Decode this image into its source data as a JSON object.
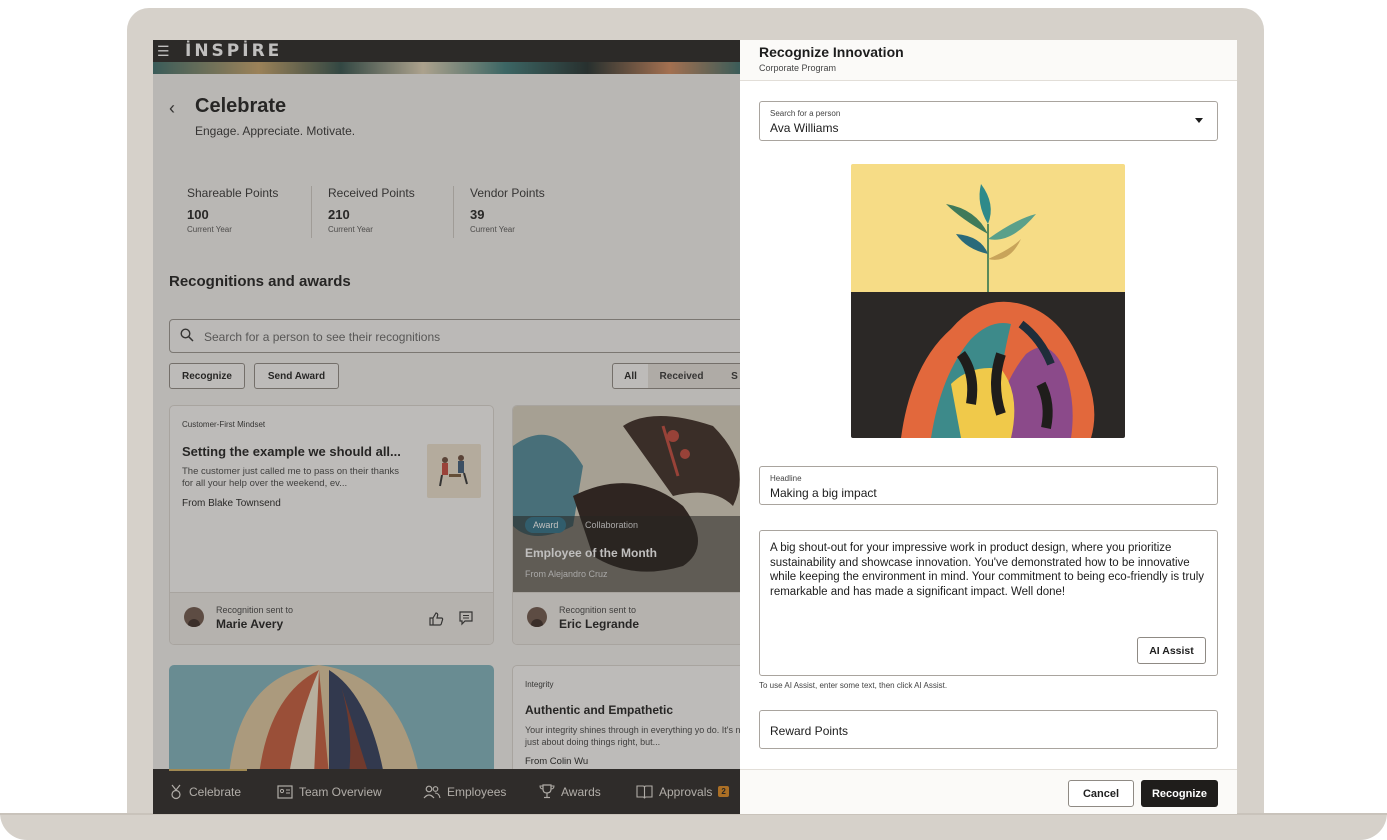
{
  "app": {
    "brand": "İNSPİRE",
    "page_title": "Celebrate",
    "page_subtitle": "Engage. Appreciate. Motivate.",
    "points": [
      {
        "label": "Shareable Points",
        "value": "100",
        "period": "Current Year"
      },
      {
        "label": "Received Points",
        "value": "210",
        "period": "Current Year"
      },
      {
        "label": "Vendor Points",
        "value": "39",
        "period": "Current Year"
      }
    ],
    "section_title": "Recognitions and awards",
    "search_placeholder": "Search for a person to see their recognitions",
    "actions": {
      "recognize": "Recognize",
      "send_award": "Send Award"
    },
    "filters": [
      "All",
      "Received",
      "S"
    ],
    "cards": [
      {
        "category": "Customer-First Mindset",
        "title": "Setting the example we should all...",
        "description": "The customer just called me to pass on their thanks for all your help over the weekend, ev...",
        "from": "From Blake Townsend",
        "sent_label": "Recognition sent to",
        "sent_to": "Marie Avery"
      },
      {
        "tag": "Award",
        "tag2": "Collaboration",
        "title": "Employee of the Month",
        "from": "From Alejandro Cruz",
        "sent_label": "Recognition sent to",
        "sent_to": "Eric Legrande"
      },
      {
        "category": "Integrity",
        "title": "Authentic and Empathetic",
        "description": "Your integrity shines through in everything yo do. It's not just about doing things right, but...",
        "from": "From Colin Wu"
      }
    ],
    "nav": [
      {
        "label": "Celebrate",
        "icon": "medal-icon"
      },
      {
        "label": "Team Overview",
        "icon": "id-card-icon"
      },
      {
        "label": "Employees",
        "icon": "people-icon"
      },
      {
        "label": "Awards",
        "icon": "trophy-icon"
      },
      {
        "label": "Approvals",
        "icon": "book-icon",
        "badge": "2"
      }
    ]
  },
  "panel": {
    "title": "Recognize Innovation",
    "subtitle": "Corporate Program",
    "person_label": "Search for a person",
    "person_value": "Ava Williams",
    "headline_label": "Headline",
    "headline_value": "Making a big impact",
    "message": "A big shout-out for your impressive work in product design, where you prioritize sustainability and showcase innovation. You've demonstrated how to be innovative while keeping the environment in mind. Your commitment to being eco-friendly is truly remarkable and has made a significant impact. Well done!",
    "ai_assist": "AI Assist",
    "hint": "To use AI Assist, enter some text, then click AI Assist.",
    "reward_placeholder": "Reward Points",
    "cancel": "Cancel",
    "recognize": "Recognize"
  },
  "colors": {
    "accent_gold": "#d2b262",
    "badge_orange": "#e08a1e",
    "award_tag": "#2d6f86",
    "dark": "#1f1d1b"
  }
}
